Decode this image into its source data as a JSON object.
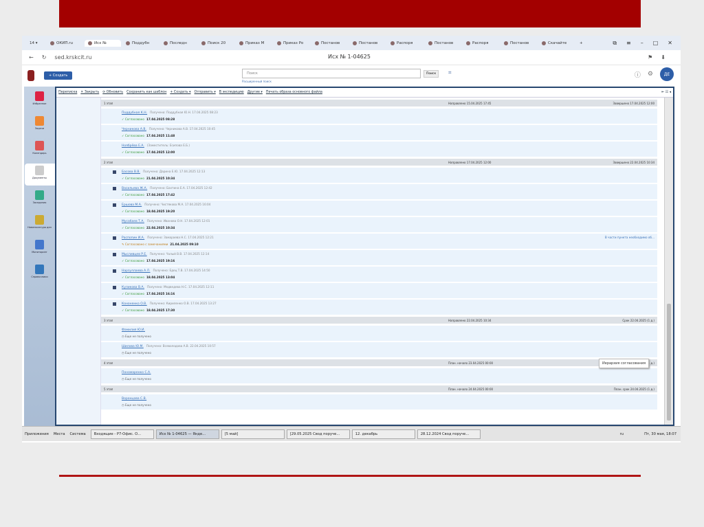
{
  "browser": {
    "tabs": [
      "ОКИП.ru",
      "Исх №",
      "Поддубн",
      "Последн",
      "Поиск 20",
      "Приказ М",
      "Приказ Ро",
      "Постанов",
      "Постанов",
      "Распоря",
      "Постанов",
      "Распоря",
      "Постанов",
      "Скачайте"
    ],
    "url": "sed.krskcit.ru",
    "page_title": "Исх № 1-04625"
  },
  "header": {
    "create": "+ Создать",
    "search_placeholder": "Поиск",
    "advanced_search": "Расширенный поиск",
    "search_button": "Поиск",
    "avatar": "ДЕ"
  },
  "sidebar": [
    "Избранное",
    "Задачи",
    "Календарь",
    "Документы",
    "Заседания",
    "Номенклатура дел",
    "Мониторинг",
    "Справочники"
  ],
  "toolbar": [
    "Переписка",
    "✕ Закрыть",
    "⟳ Обновить",
    "Сохранить как шаблон",
    "+ Создать ▾",
    "Отправить ▾",
    "В экспедицию",
    "Другие ▾",
    "Печать образа основного файла"
  ],
  "list": [
    {
      "type": "stage",
      "label": "1 этап",
      "mid": "Направлено 15.04.2025 17:45",
      "right": "Завершено 17.04.2025 12:00"
    },
    {
      "type": "row",
      "name": "Поддубная К.Н.",
      "info": "Получено: Поддубная Ю.Н. 17.04.2025 08:23",
      "status": "✓ Согласовано",
      "date": "17.04.2025 08:28"
    },
    {
      "type": "row",
      "name": "Черникова А.В.",
      "info": "Получено: Черникова А.В. 17.04.2025 10:45",
      "status": "✓ Согласовано",
      "date": "17.04.2025 11:48"
    },
    {
      "type": "row",
      "name": "Ноябрёва Е.А.",
      "info": "(Заместитель: Есипова Е.Б.)",
      "status": "✓ Согласовано",
      "date": "17.04.2025 12:00"
    },
    {
      "type": "stage",
      "label": "2 этап",
      "mid": "Направлено 17.04.2025 12:00",
      "right": "Завершено 22.04.2025 10:34"
    },
    {
      "type": "row",
      "plus": true,
      "name": "Басова В.В.",
      "info": "Получено: Дарина Е.Ю. 17.04.2025 12:13",
      "status": "✓ Согласовано",
      "date": "21.04.2025 10:34"
    },
    {
      "type": "row",
      "plus": true,
      "name": "Васильева Ж.А.",
      "info": "Получено: Бахтина Е.А. 17.04.2025 12:42",
      "status": "✓ Согласовано",
      "date": "17.04.2025 17:42"
    },
    {
      "type": "row",
      "plus": true,
      "name": "Ершова М.А.",
      "info": "Получено: Чистякова М.А. 17.04.2025 16:04",
      "status": "✓ Согласовано",
      "date": "18.04.2025 19:20"
    },
    {
      "type": "row",
      "name": "Мусабаев Т.А.",
      "info": "Получено: Иванова О.Н. 17.04.2025 12:01",
      "status": "✓ Согласовано",
      "date": "22.04.2025 10:34"
    },
    {
      "type": "row",
      "plus": true,
      "name": "Распопин И.А.",
      "info": "Получено: Замараева Н.С. 17.04.2025 12:21",
      "status": "✎ Согласовано с замечаниями",
      "warn": true,
      "date": "21.04.2025 09:10",
      "link": "В части пункта необходимо об..."
    },
    {
      "type": "row",
      "plus": true,
      "name": "Мысливцев Р.Е.",
      "info": "Получено: Чалый В.В. 17.04.2025 12:14",
      "status": "✓ Согласовано",
      "date": "17.04.2025 19:16"
    },
    {
      "type": "row",
      "plus": true,
      "name": "Нарзуллаева А.Л.",
      "info": "Получено: Едец Т.В. 17.04.2025 14:50",
      "status": "✓ Согласовано",
      "date": "18.04.2025 13:04"
    },
    {
      "type": "row",
      "plus": true,
      "name": "Куликова В.А.",
      "info": "Получено: Медведева Н.С. 17.04.2025 12:11",
      "status": "✓ Согласовано",
      "date": "17.04.2025 16:16"
    },
    {
      "type": "row",
      "plus": true,
      "name": "Кононенко О.В.",
      "info": "Получено: Кириленко О.В. 17.04.2025 13:27",
      "status": "✓ Согласовано",
      "date": "18.04.2025 17:30"
    },
    {
      "type": "stage",
      "label": "3 этап",
      "mid": "Направлено 22.04.2025 10:34",
      "right": "Срок 22.04.2025 (1 д.)"
    },
    {
      "type": "row",
      "name": "Фамилия Ю.И.",
      "info": "",
      "status": "◷ Еще не получено",
      "gray": true
    },
    {
      "type": "row",
      "name": "Шилова Ю.М.",
      "info": "Получено: Всеволодова А.В. 22.04.2025 10:57",
      "status": "◷ Еще не получено",
      "gray": true
    },
    {
      "type": "stage",
      "label": "4 этап",
      "mid": "План. начало 23.04.2025 00:00",
      "right": "План. срок 23.04.2025 (1 д.)"
    },
    {
      "type": "row",
      "name": "Пономаренко С.А.",
      "info": "",
      "status": "◷ Еще не получено",
      "gray": true
    },
    {
      "type": "stage",
      "label": "5 этап",
      "mid": "План. начало 24.04.2025 00:00",
      "right": "План. срок 24.04.2025 (1 д.)"
    },
    {
      "type": "row",
      "name": "Воронцова С.В.",
      "info": "",
      "status": "◷ Еще не получено",
      "gray": true
    }
  ],
  "tooltip": "Иерархия согласования",
  "taskbar": {
    "menu": [
      "Приложения",
      "Места",
      "Система"
    ],
    "windows": [
      "Входящие - Р7-Офис. О...",
      "Исх № 1-04625 — Янде...",
      "[5 май]",
      "[29.05.2025 Свод поруче...",
      "12. декабрь",
      "28.12.2024 Свод поруче..."
    ],
    "lang": "ru",
    "clock": "Пт, 30 мая, 18:07"
  }
}
